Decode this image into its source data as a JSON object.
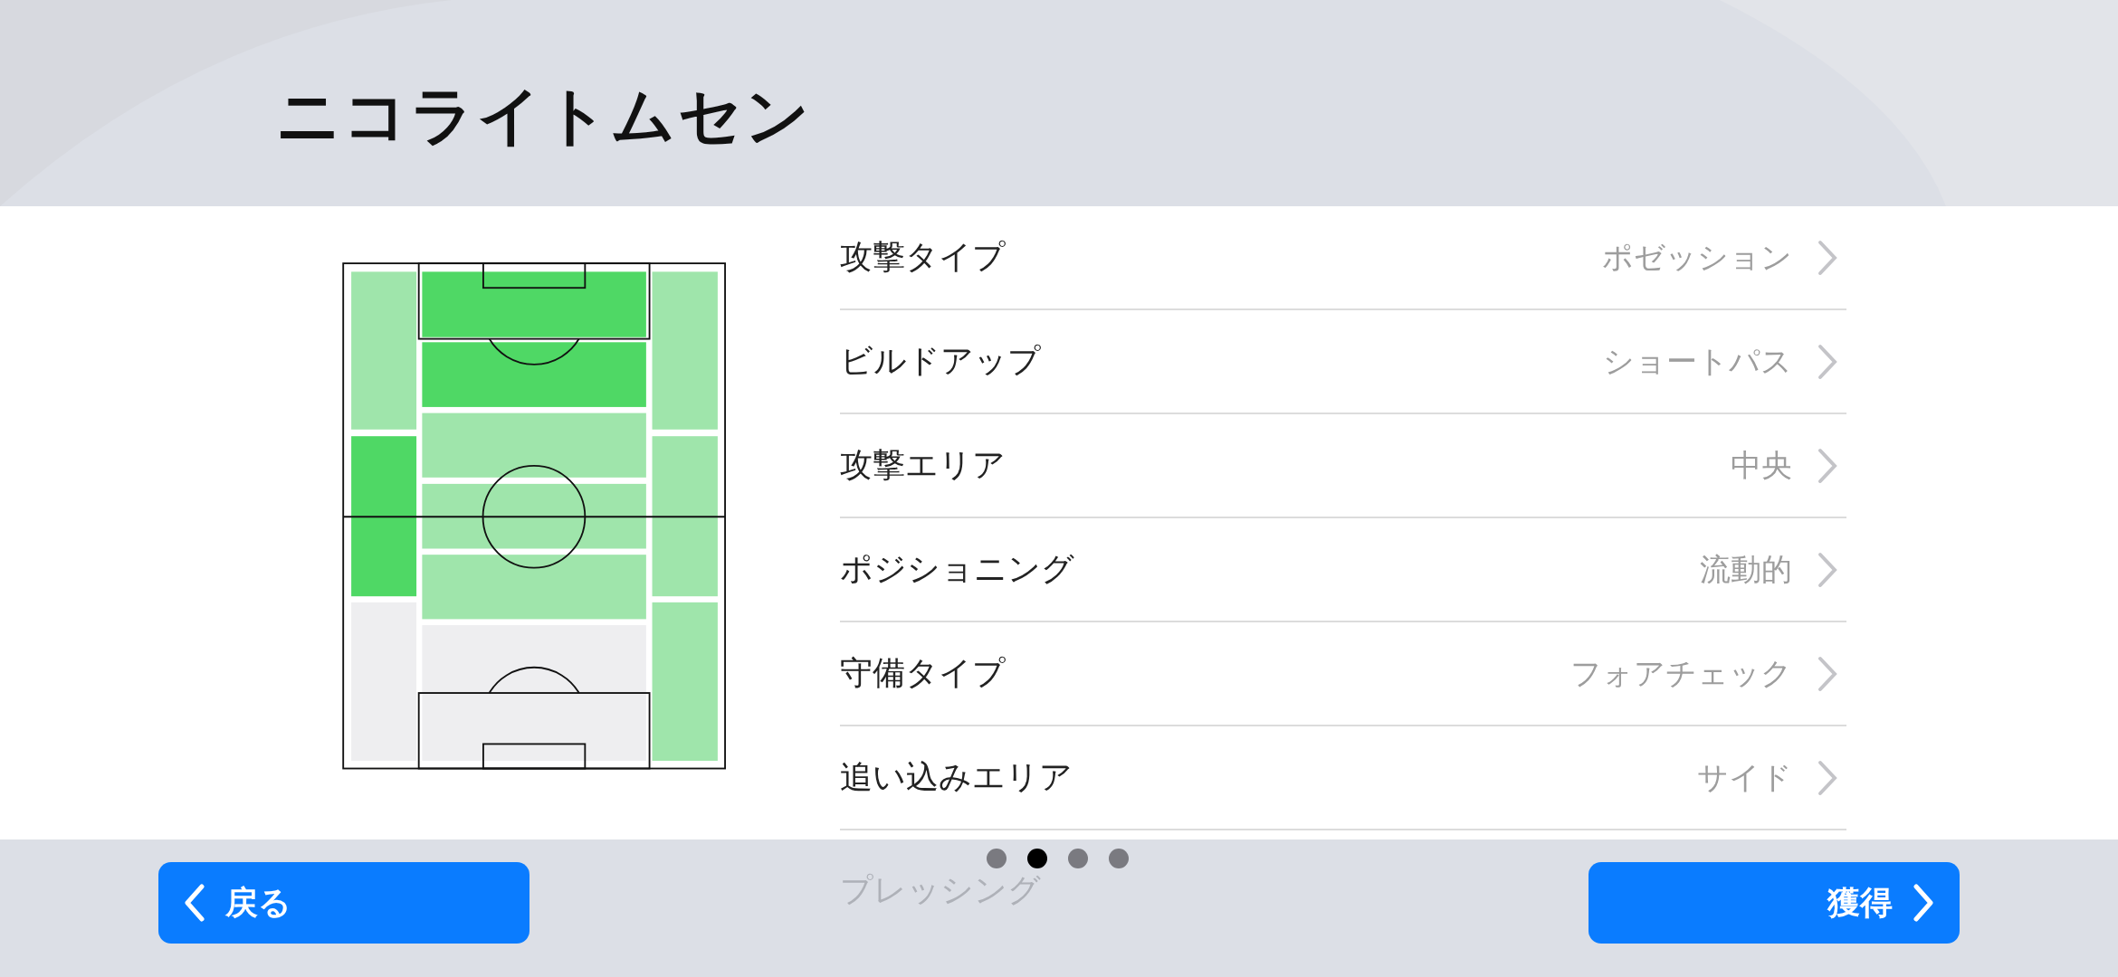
{
  "title": "ニコライトムセン",
  "pitch": {
    "zones": [
      {
        "color": "#9fe5ab"
      },
      {
        "color": "#4fd865"
      },
      {
        "color": "#eeeef0"
      },
      {
        "color": "#4fd865"
      },
      {
        "color": "#4fd865"
      },
      {
        "color": "#9fe5ab"
      },
      {
        "color": "#9fe5ab"
      },
      {
        "color": "#9fe5ab"
      },
      {
        "color": "#eeeef0"
      },
      {
        "color": "#9fe5ab"
      },
      {
        "color": "#9fe5ab"
      },
      {
        "color": "#9fe5ab"
      }
    ]
  },
  "settings": [
    {
      "label": "攻撃タイプ",
      "value": "ポゼッション"
    },
    {
      "label": "ビルドアップ",
      "value": "ショートパス"
    },
    {
      "label": "攻撃エリア",
      "value": "中央"
    },
    {
      "label": "ポジショニング",
      "value": "流動的"
    },
    {
      "label": "守備タイプ",
      "value": "フォアチェック"
    },
    {
      "label": "追い込みエリア",
      "value": "サイド"
    }
  ],
  "next_row_label": "プレッシング",
  "pages": [
    {
      "selected": false
    },
    {
      "selected": true
    },
    {
      "selected": false
    },
    {
      "selected": false
    }
  ],
  "buttons": {
    "back": "戻る",
    "acquire": "獲得"
  }
}
